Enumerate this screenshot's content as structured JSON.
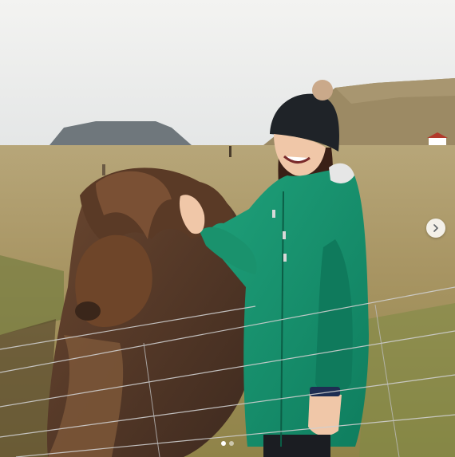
{
  "post": {
    "image_alt": "",
    "carousel": {
      "total_slides": 2,
      "current_slide": 1
    },
    "icons": {
      "next": "chevron-right-icon"
    },
    "colors": {
      "dot_active": "#ffffff",
      "dot_inactive": "rgba(255,255,255,0.55)"
    }
  }
}
